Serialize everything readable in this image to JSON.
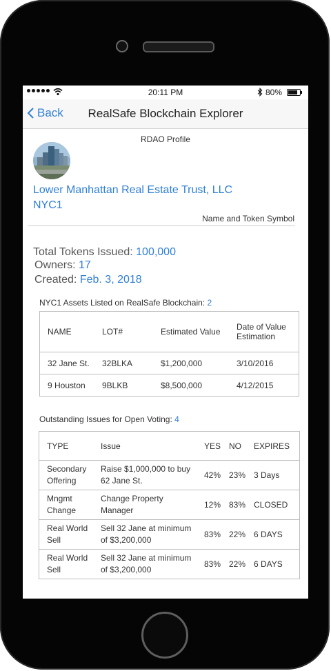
{
  "status_bar": {
    "time": "20:11 PM",
    "battery": "80%"
  },
  "nav": {
    "back_label": "Back",
    "title": "RealSafe Blockchain Explorer"
  },
  "profile": {
    "section_label": "RDAO Profile",
    "name": "Lower Manhattan Real Estate Trust, LLC",
    "symbol": "NYC1",
    "name_symbol_label": "Name and Token Symbol"
  },
  "stats": {
    "tokens_label": "Total Tokens Issued:",
    "tokens_value": "100,000",
    "owners_label": "Owners:",
    "owners_value": "17",
    "created_label": "Created:",
    "created_value": "Feb. 3, 2018"
  },
  "assets": {
    "title": "NYC1 Assets Listed on RealSafe Blockchain:",
    "count": "2",
    "headers": [
      "NAME",
      "LOT#",
      "Estimated Value",
      "Date of Value Estimation"
    ],
    "rows": [
      [
        "32 Jane St.",
        "32BLKA",
        "$1,200,000",
        "3/10/2016"
      ],
      [
        "9 Houston",
        "9BLKB",
        "$8,500,000",
        "4/12/2015"
      ]
    ]
  },
  "issues": {
    "title": "Outstanding Issues for Open Voting:",
    "count": "4",
    "headers": [
      "TYPE",
      "Issue",
      "YES",
      "NO",
      "EXPIRES"
    ],
    "rows": [
      [
        "Secondary Offering",
        "Raise $1,000,000 to buy 62 Jane St.",
        "42%",
        "23%",
        "3 Days"
      ],
      [
        "Mngmt Change",
        "Change Property Manager",
        "12%",
        "83%",
        "CLOSED"
      ],
      [
        "Real World Sell",
        "Sell 32 Jane at minimum of $3,200,000",
        "83%",
        "22%",
        "6 DAYS"
      ],
      [
        "Real World Sell",
        "Sell 32 Jane at minimum of $3,200,000",
        "83%",
        "22%",
        "6 DAYS"
      ]
    ]
  },
  "colors": {
    "accent": "#2f7fd6",
    "phone_body": "#050505"
  },
  "icons": [
    "signal-dots-icon",
    "wifi-icon",
    "bluetooth-icon",
    "battery-icon",
    "chevron-left-icon"
  ]
}
